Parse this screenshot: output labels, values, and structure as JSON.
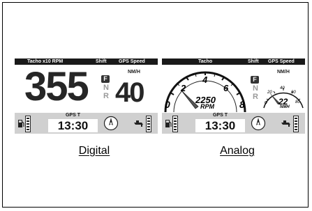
{
  "digital": {
    "header": {
      "tacho": "Tacho x10 RPM",
      "shift": "Shift",
      "gps_speed": "GPS Speed"
    },
    "rpm_value": "355",
    "gear_active": "F",
    "gear_neutral": "N",
    "gear_reverse": "R",
    "speed_unit": "NM/H",
    "speed_value": "40",
    "gps_time_label": "GPS T",
    "gps_time": "13:30",
    "caption": "Digital"
  },
  "analog": {
    "header": {
      "tacho": "Tacho",
      "shift": "Shift",
      "gps_speed": "GPS Speed"
    },
    "tacho_ticks": [
      "0",
      "2",
      "4",
      "6",
      "8"
    ],
    "rpm_value": "2250",
    "rpm_label": "RPM",
    "gear_active": "F",
    "gear_neutral": "N",
    "gear_reverse": "R",
    "speed_unit": "NM/H",
    "speed_ticks": [
      "o",
      "20",
      "40",
      "60",
      "80"
    ],
    "speed_value": "22",
    "speed_sub_unit": "NMH",
    "gps_time_label": "GPS T",
    "gps_time": "13:30",
    "caption": "Analog"
  }
}
